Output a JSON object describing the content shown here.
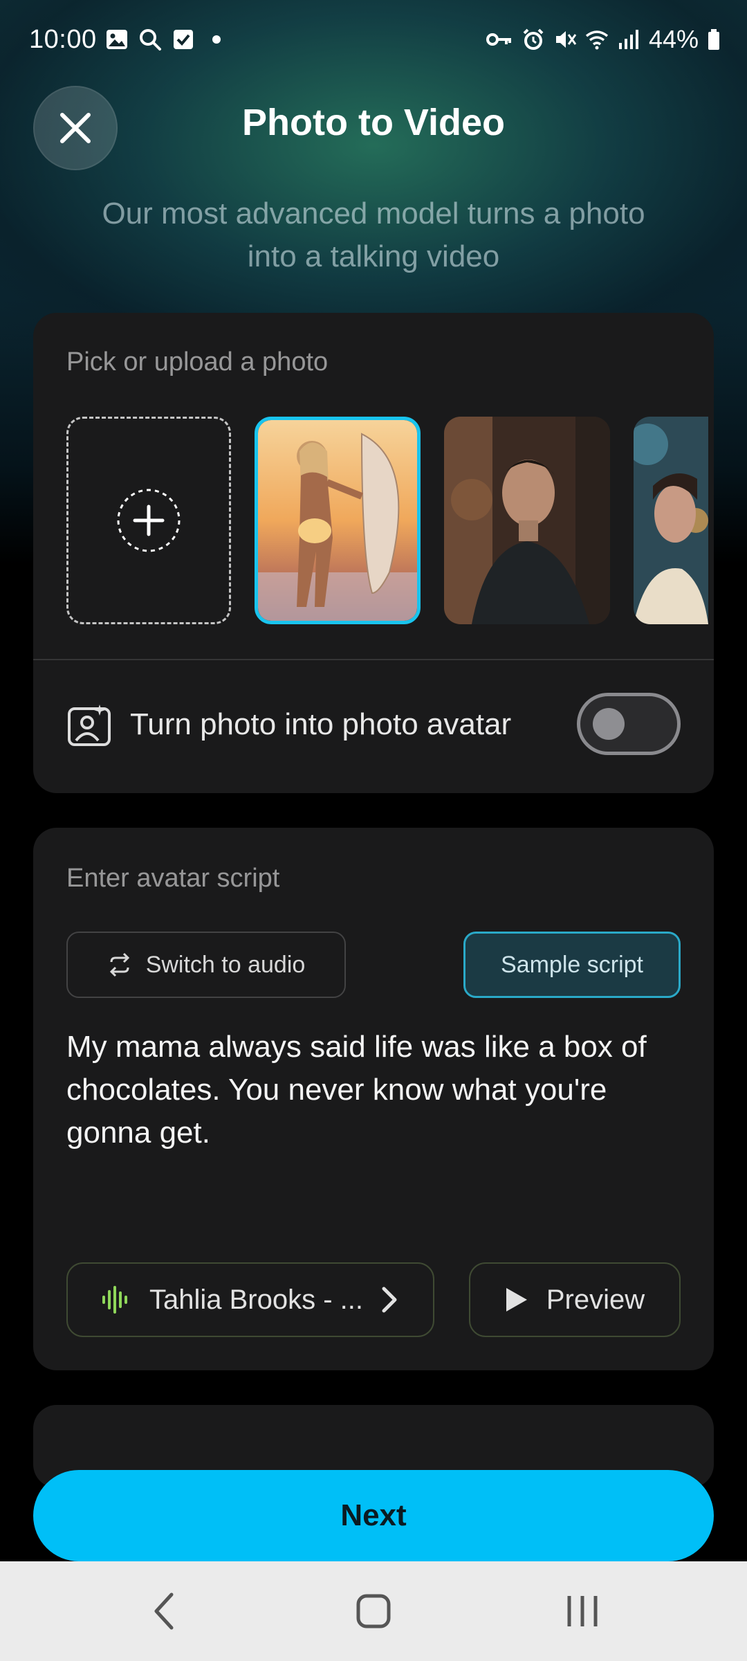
{
  "status_bar": {
    "time": "10:00",
    "battery": "44%",
    "left_icons": [
      "gallery-icon",
      "search-icon",
      "checkbox-icon",
      "dot-icon"
    ],
    "right_icons": [
      "vpn-key-icon",
      "alarm-icon",
      "mute-icon",
      "wifi-icon",
      "signal-icon",
      "battery-icon"
    ]
  },
  "header": {
    "title": "Photo to Video",
    "subtitle": "Our most advanced model turns a photo into a talking video"
  },
  "photo_section": {
    "label": "Pick or upload a photo",
    "photos": [
      {
        "desc": "woman-with-surfboard",
        "selected": true
      },
      {
        "desc": "man-in-rain-jacket",
        "selected": false
      },
      {
        "desc": "woman-partial",
        "selected": false
      }
    ],
    "avatar_toggle_label": "Turn photo into photo avatar",
    "avatar_toggle_on": false
  },
  "script_section": {
    "label": "Enter avatar script",
    "switch_label": "Switch to audio",
    "sample_label": "Sample script",
    "script_text": "My mama always said life was like a box of chocolates. You never know what you're gonna get.",
    "voice_label": "Tahlia Brooks - ...",
    "preview_label": "Preview"
  },
  "actions": {
    "next_label": "Next"
  },
  "colors": {
    "accent": "#00bff7",
    "selected_border": "#19c4ee",
    "voice_wave": "#8fd65a"
  }
}
